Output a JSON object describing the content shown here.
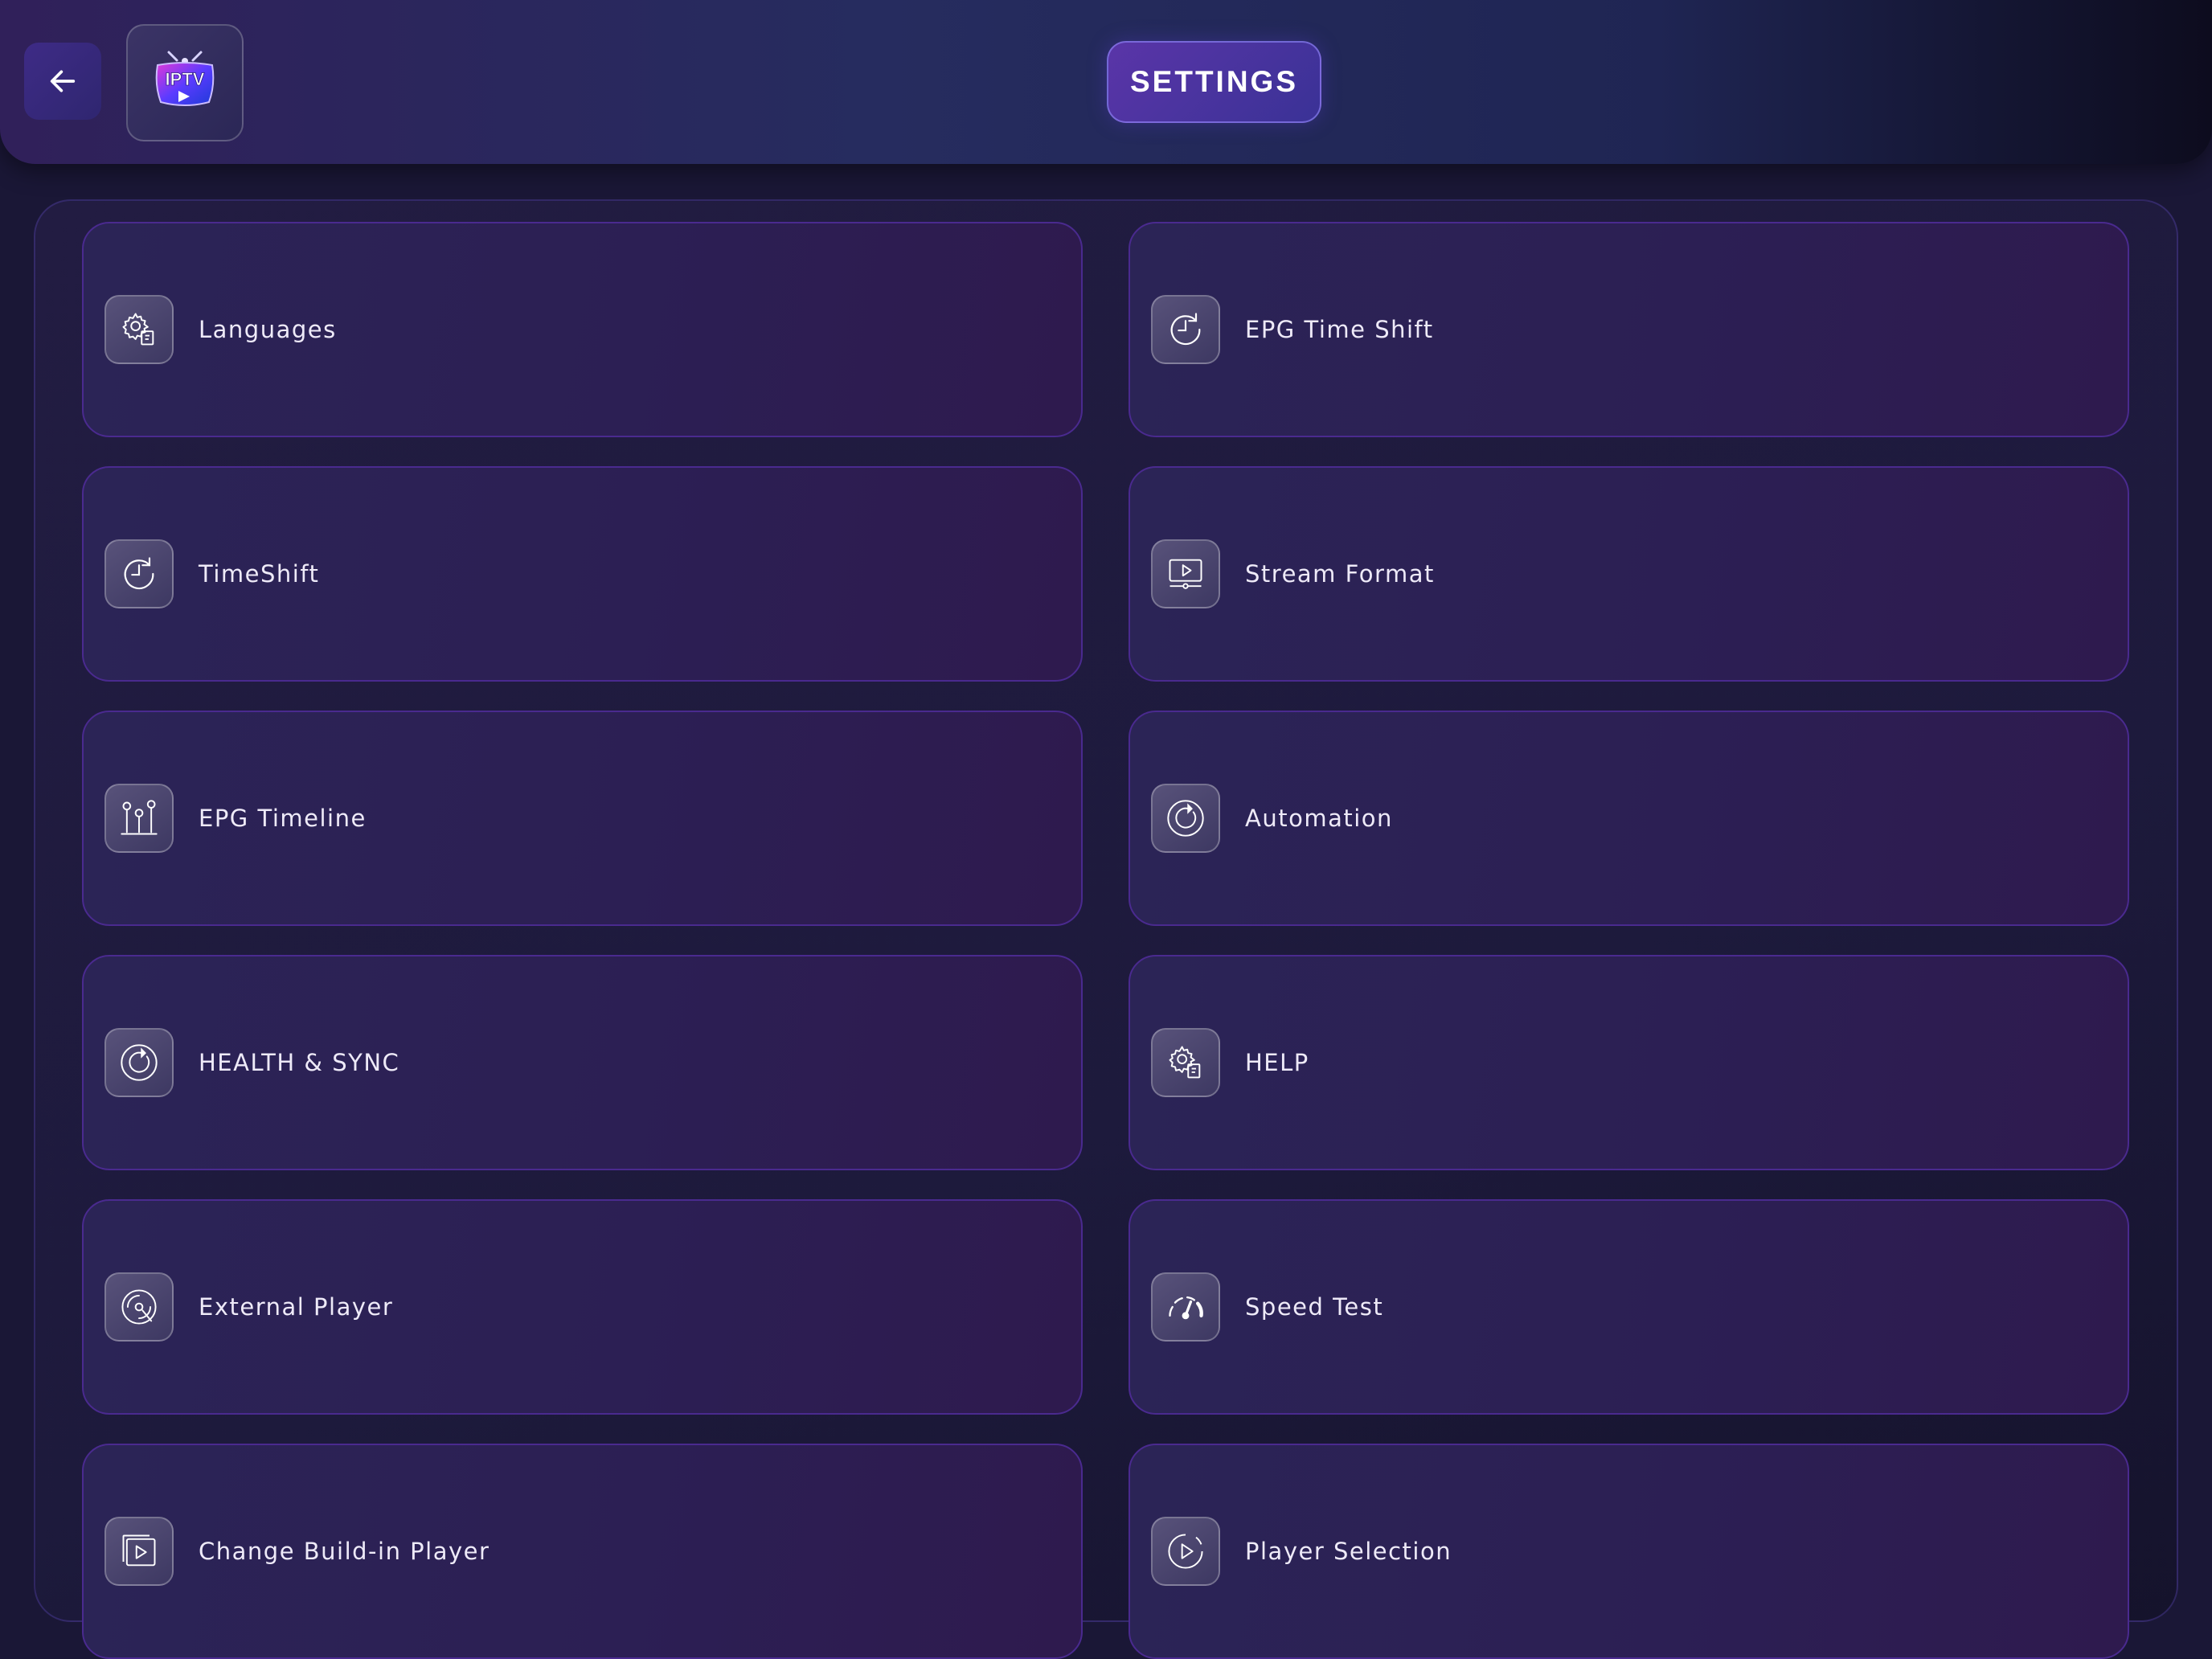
{
  "header": {
    "title": "SETTINGS",
    "logo_text": "IPTV"
  },
  "settings": [
    {
      "label": "Languages",
      "icon": "gear-document-icon"
    },
    {
      "label": "EPG Time Shift",
      "icon": "clock-rotate-icon"
    },
    {
      "label": "TimeShift",
      "icon": "clock-rotate-icon"
    },
    {
      "label": "Stream Format",
      "icon": "monitor-play-icon"
    },
    {
      "label": "EPG Timeline",
      "icon": "sliders-pins-icon"
    },
    {
      "label": "Automation",
      "icon": "refresh-circle-icon"
    },
    {
      "label": "HEALTH & SYNC",
      "icon": "refresh-circle-icon"
    },
    {
      "label": "HELP",
      "icon": "gear-document-icon"
    },
    {
      "label": "External Player",
      "icon": "disc-icon"
    },
    {
      "label": "Speed Test",
      "icon": "speedometer-icon"
    },
    {
      "label": "Change Build-in Player",
      "icon": "player-window-icon"
    },
    {
      "label": "Player Selection",
      "icon": "play-circle-icon"
    }
  ]
}
